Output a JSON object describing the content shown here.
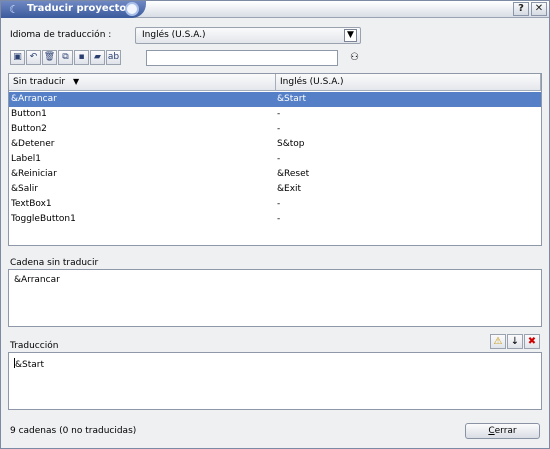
{
  "window": {
    "title": "Traducir proyecto",
    "help_label": "?",
    "close_label": "✕"
  },
  "language": {
    "label": "Idioma de traducción :",
    "selected": "Inglés (U.S.A.)"
  },
  "toolbar": {
    "search_value": "",
    "find_icon": "binoculars-icon"
  },
  "table": {
    "columns": [
      "Sin traducir",
      "Inglés (U.S.A.)"
    ],
    "rows": [
      {
        "source": "&Arrancar",
        "translation": "&Start",
        "selected": true
      },
      {
        "source": "Button1",
        "translation": "-"
      },
      {
        "source": "Button2",
        "translation": "-"
      },
      {
        "source": "&Detener",
        "translation": "S&top"
      },
      {
        "source": "Label1",
        "translation": "-"
      },
      {
        "source": "&Reiniciar",
        "translation": "&Reset"
      },
      {
        "source": "&Salir",
        "translation": "&Exit"
      },
      {
        "source": "TextBox1",
        "translation": "-"
      },
      {
        "source": "ToggleButton1",
        "translation": "-"
      }
    ]
  },
  "untranslated": {
    "label": "Cadena sin traducir",
    "value": "&Arrancar"
  },
  "translation": {
    "label": "Traducción",
    "value": "&Start"
  },
  "status": {
    "text": "9 cadenas (0 no traducidas)"
  },
  "close_button": {
    "label_underlined": "C",
    "label_rest": "errar"
  },
  "colors": {
    "selection": "#5580c8",
    "title_tab": "#3a5a9c"
  }
}
